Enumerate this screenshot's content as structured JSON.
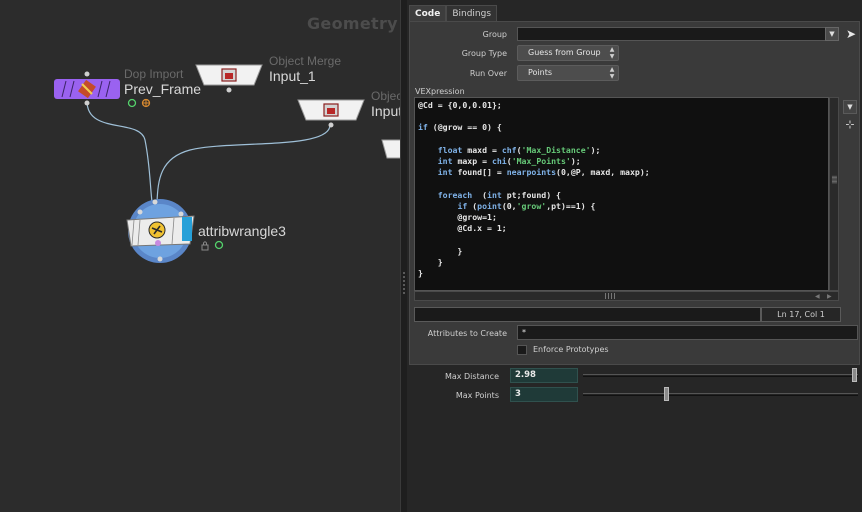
{
  "network": {
    "context_title": "Geometry",
    "nodes": [
      {
        "id": "dop_import",
        "type_label": "Dop Import",
        "name": "Prev_Frame"
      },
      {
        "id": "object_merge_1",
        "type_label": "Object Merge",
        "name": "Input_1"
      },
      {
        "id": "object_merge_2",
        "type_label": "Object",
        "name": "Input"
      },
      {
        "id": "attribwrangle",
        "type_label": "",
        "name": "attribwrangle3"
      }
    ],
    "colors": {
      "dop_import": "#9a62f0",
      "wire": "#9fc0d8",
      "wrangle_ring": "#6ea2e0",
      "wrangle_accent": "#27a0d8"
    }
  },
  "params": {
    "tabs": [
      "Code",
      "Bindings"
    ],
    "active_tab": "Code",
    "group": {
      "label": "Group",
      "value": ""
    },
    "group_type": {
      "label": "Group Type",
      "value": "Guess from Group"
    },
    "run_over": {
      "label": "Run Over",
      "value": "Points"
    },
    "vexpression": {
      "label": "VEXpression",
      "code_lines": [
        "@Cd = {0,0,0.01};",
        "",
        "if (@grow == 0) {",
        "",
        "    float maxd = chf('Max_Distance');",
        "    int maxp = chi('Max_Points');",
        "    int found[] = nearpoints(0,@P, maxd, maxp);",
        "",
        "    foreach  (int pt;found) {",
        "        if (point(0,'grow',pt)==1) {",
        "        @grow=1;",
        "        @Cd.x = 1;",
        "",
        "        }",
        "    }",
        "}"
      ],
      "cursor_status": "Ln 17, Col 1"
    },
    "attributes_to_create": {
      "label": "Attributes to Create",
      "value": "*"
    },
    "enforce_prototypes": {
      "label": "Enforce Prototypes",
      "checked": false
    },
    "spare": [
      {
        "label": "Max Distance",
        "value": "2.98",
        "fraction": 0.995
      },
      {
        "label": "Max Points",
        "value": "3",
        "fraction": 0.3
      }
    ]
  }
}
